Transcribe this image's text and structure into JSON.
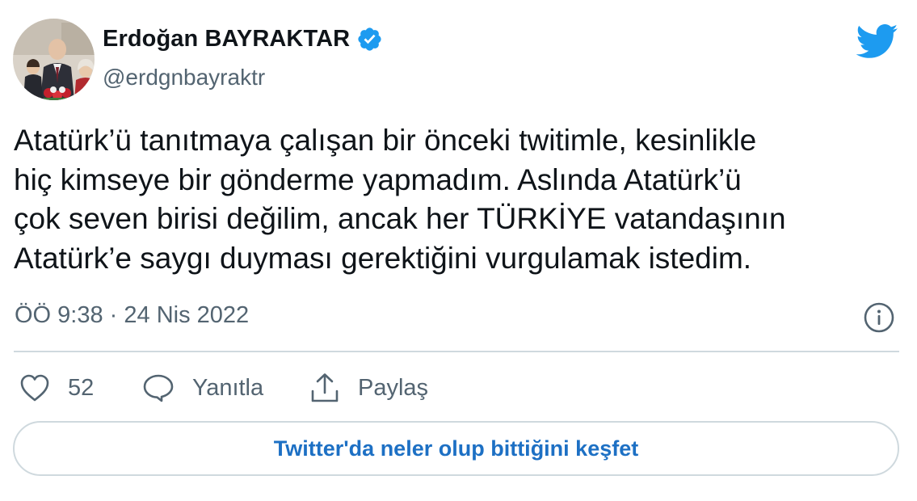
{
  "author": {
    "display_name": "Erdoğan BAYRAKTAR",
    "handle": "@erdgnbayraktr",
    "verified": true
  },
  "tweet": {
    "text_lines": [
      "Atatürk’ü tanıtmaya çalışan bir önceki twitimle, kesinlikle",
      "hiç kimseye bir gönderme yapmadım. Aslında Atatürk’ü",
      "çok seven birisi değilim, ancak her TÜRKİYE vatandaşının",
      "Atatürk’e saygı duyması gerektiğini vurgulamak istedim."
    ],
    "timestamp": "ÖÖ 9:38 · 24 Nis 2022"
  },
  "actions": {
    "like_count": "52",
    "reply_label": "Yanıtla",
    "share_label": "Paylaş"
  },
  "explore_button": {
    "label": "Twitter'da neler olup bittiğini keşfet"
  },
  "icons": {
    "verified": "verified-badge-icon",
    "logo": "twitter-bird-icon",
    "info": "info-icon",
    "like": "heart-icon",
    "reply": "speech-bubble-icon",
    "share": "share-upload-icon"
  },
  "colors": {
    "brand_blue": "#1d9bf0",
    "link_blue": "#1d70c4",
    "text_primary": "#0f1419",
    "text_secondary": "#536471",
    "border": "#cfd9de"
  }
}
